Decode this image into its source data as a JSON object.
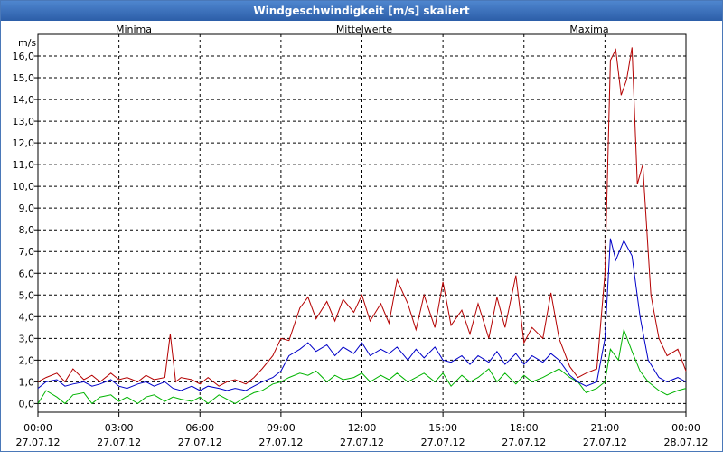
{
  "window": {
    "title": "Windgeschwindigkeit [m/s] skaliert"
  },
  "chart_data": {
    "type": "line",
    "title": "Windgeschwindigkeit [m/s] skaliert",
    "ylabel": "m/s",
    "xlabel": "",
    "ylim": [
      -0.4,
      17.0
    ],
    "xlim": [
      0,
      24
    ],
    "y_ticks": [
      0,
      1,
      2,
      3,
      4,
      5,
      6,
      7,
      8,
      9,
      10,
      11,
      12,
      13,
      14,
      15,
      16
    ],
    "y_tick_labels": [
      "0,0",
      "1,0",
      "2,0",
      "3,0",
      "4,0",
      "5,0",
      "6,0",
      "7,0",
      "8,0",
      "9,0",
      "10,0",
      "11,0",
      "12,0",
      "13,0",
      "14,0",
      "15,0",
      "16,0"
    ],
    "x_ticks": [
      {
        "time": "00:00",
        "date": "27.07.12"
      },
      {
        "time": "03:00",
        "date": "27.07.12"
      },
      {
        "time": "06:00",
        "date": "27.07.12"
      },
      {
        "time": "09:00",
        "date": "27.07.12"
      },
      {
        "time": "12:00",
        "date": "27.07.12"
      },
      {
        "time": "15:00",
        "date": "27.07.12"
      },
      {
        "time": "18:00",
        "date": "27.07.12"
      },
      {
        "time": "21:00",
        "date": "27.07.12"
      },
      {
        "time": "00:00",
        "date": "28.07.12"
      }
    ],
    "grid": true,
    "legend_position": "top",
    "series": [
      {
        "name": "Minima",
        "color": "#00b400",
        "points": [
          [
            0.0,
            0.0
          ],
          [
            0.3,
            0.6
          ],
          [
            0.7,
            0.3
          ],
          [
            1.0,
            0.0
          ],
          [
            1.3,
            0.4
          ],
          [
            1.7,
            0.5
          ],
          [
            2.0,
            0.0
          ],
          [
            2.3,
            0.3
          ],
          [
            2.7,
            0.4
          ],
          [
            3.0,
            0.1
          ],
          [
            3.3,
            0.3
          ],
          [
            3.7,
            0.0
          ],
          [
            4.0,
            0.3
          ],
          [
            4.3,
            0.4
          ],
          [
            4.7,
            0.1
          ],
          [
            5.0,
            0.3
          ],
          [
            5.3,
            0.2
          ],
          [
            5.7,
            0.1
          ],
          [
            6.0,
            0.3
          ],
          [
            6.3,
            0.0
          ],
          [
            6.7,
            0.4
          ],
          [
            7.0,
            0.2
          ],
          [
            7.3,
            0.0
          ],
          [
            7.7,
            0.3
          ],
          [
            8.0,
            0.5
          ],
          [
            8.3,
            0.6
          ],
          [
            8.7,
            0.9
          ],
          [
            9.0,
            1.0
          ],
          [
            9.3,
            1.2
          ],
          [
            9.7,
            1.4
          ],
          [
            10.0,
            1.3
          ],
          [
            10.3,
            1.5
          ],
          [
            10.7,
            1.0
          ],
          [
            11.0,
            1.3
          ],
          [
            11.3,
            1.1
          ],
          [
            11.7,
            1.2
          ],
          [
            12.0,
            1.4
          ],
          [
            12.3,
            1.0
          ],
          [
            12.7,
            1.3
          ],
          [
            13.0,
            1.1
          ],
          [
            13.3,
            1.4
          ],
          [
            13.7,
            1.0
          ],
          [
            14.0,
            1.2
          ],
          [
            14.3,
            1.4
          ],
          [
            14.7,
            1.0
          ],
          [
            15.0,
            1.4
          ],
          [
            15.3,
            0.8
          ],
          [
            15.7,
            1.3
          ],
          [
            16.0,
            1.0
          ],
          [
            16.3,
            1.2
          ],
          [
            16.7,
            1.6
          ],
          [
            17.0,
            1.0
          ],
          [
            17.3,
            1.4
          ],
          [
            17.7,
            0.9
          ],
          [
            18.0,
            1.3
          ],
          [
            18.3,
            1.0
          ],
          [
            18.7,
            1.2
          ],
          [
            19.0,
            1.4
          ],
          [
            19.3,
            1.6
          ],
          [
            19.7,
            1.2
          ],
          [
            20.0,
            1.0
          ],
          [
            20.3,
            0.5
          ],
          [
            20.7,
            0.7
          ],
          [
            21.0,
            1.0
          ],
          [
            21.2,
            2.5
          ],
          [
            21.5,
            2.0
          ],
          [
            21.7,
            3.4
          ],
          [
            22.0,
            2.4
          ],
          [
            22.3,
            1.5
          ],
          [
            22.6,
            1.0
          ],
          [
            23.0,
            0.6
          ],
          [
            23.3,
            0.4
          ],
          [
            23.7,
            0.6
          ],
          [
            24.0,
            0.7
          ]
        ]
      },
      {
        "name": "Mittelwerte",
        "color": "#0000c8",
        "points": [
          [
            0.0,
            0.7
          ],
          [
            0.3,
            1.0
          ],
          [
            0.7,
            1.1
          ],
          [
            1.0,
            0.8
          ],
          [
            1.3,
            0.9
          ],
          [
            1.7,
            1.0
          ],
          [
            2.0,
            0.8
          ],
          [
            2.3,
            0.9
          ],
          [
            2.7,
            1.1
          ],
          [
            3.0,
            0.8
          ],
          [
            3.3,
            0.7
          ],
          [
            3.7,
            0.9
          ],
          [
            4.0,
            1.0
          ],
          [
            4.3,
            0.8
          ],
          [
            4.7,
            1.0
          ],
          [
            5.0,
            0.7
          ],
          [
            5.3,
            0.6
          ],
          [
            5.7,
            0.8
          ],
          [
            6.0,
            0.6
          ],
          [
            6.3,
            0.8
          ],
          [
            6.7,
            0.7
          ],
          [
            7.0,
            0.6
          ],
          [
            7.3,
            0.7
          ],
          [
            7.7,
            0.6
          ],
          [
            8.0,
            0.8
          ],
          [
            8.3,
            1.0
          ],
          [
            8.7,
            1.2
          ],
          [
            9.0,
            1.5
          ],
          [
            9.3,
            2.2
          ],
          [
            9.7,
            2.5
          ],
          [
            10.0,
            2.8
          ],
          [
            10.3,
            2.4
          ],
          [
            10.7,
            2.7
          ],
          [
            11.0,
            2.2
          ],
          [
            11.3,
            2.6
          ],
          [
            11.7,
            2.3
          ],
          [
            12.0,
            2.8
          ],
          [
            12.3,
            2.2
          ],
          [
            12.7,
            2.5
          ],
          [
            13.0,
            2.3
          ],
          [
            13.3,
            2.6
          ],
          [
            13.7,
            2.0
          ],
          [
            14.0,
            2.5
          ],
          [
            14.3,
            2.1
          ],
          [
            14.7,
            2.6
          ],
          [
            15.0,
            2.0
          ],
          [
            15.3,
            1.9
          ],
          [
            15.7,
            2.2
          ],
          [
            16.0,
            1.8
          ],
          [
            16.3,
            2.2
          ],
          [
            16.7,
            1.9
          ],
          [
            17.0,
            2.4
          ],
          [
            17.3,
            1.8
          ],
          [
            17.7,
            2.3
          ],
          [
            18.0,
            1.8
          ],
          [
            18.3,
            2.2
          ],
          [
            18.7,
            1.9
          ],
          [
            19.0,
            2.3
          ],
          [
            19.3,
            2.0
          ],
          [
            19.7,
            1.3
          ],
          [
            20.0,
            1.0
          ],
          [
            20.3,
            0.8
          ],
          [
            20.7,
            1.0
          ],
          [
            21.0,
            3.0
          ],
          [
            21.2,
            7.6
          ],
          [
            21.4,
            6.6
          ],
          [
            21.7,
            7.5
          ],
          [
            22.0,
            6.8
          ],
          [
            22.3,
            4.0
          ],
          [
            22.6,
            2.0
          ],
          [
            23.0,
            1.2
          ],
          [
            23.3,
            1.0
          ],
          [
            23.7,
            1.2
          ],
          [
            24.0,
            1.0
          ]
        ]
      },
      {
        "name": "Maxima",
        "color": "#b40000",
        "points": [
          [
            0.0,
            1.0
          ],
          [
            0.3,
            1.2
          ],
          [
            0.7,
            1.4
          ],
          [
            1.0,
            1.0
          ],
          [
            1.3,
            1.6
          ],
          [
            1.7,
            1.1
          ],
          [
            2.0,
            1.3
          ],
          [
            2.3,
            1.0
          ],
          [
            2.7,
            1.4
          ],
          [
            3.0,
            1.1
          ],
          [
            3.3,
            1.2
          ],
          [
            3.7,
            1.0
          ],
          [
            4.0,
            1.3
          ],
          [
            4.3,
            1.1
          ],
          [
            4.7,
            1.2
          ],
          [
            4.9,
            3.2
          ],
          [
            5.1,
            1.0
          ],
          [
            5.3,
            1.2
          ],
          [
            5.7,
            1.1
          ],
          [
            6.0,
            0.9
          ],
          [
            6.3,
            1.2
          ],
          [
            6.7,
            0.8
          ],
          [
            7.0,
            1.0
          ],
          [
            7.3,
            1.1
          ],
          [
            7.7,
            0.9
          ],
          [
            8.0,
            1.2
          ],
          [
            8.3,
            1.6
          ],
          [
            8.7,
            2.2
          ],
          [
            9.0,
            3.0
          ],
          [
            9.3,
            2.9
          ],
          [
            9.7,
            4.4
          ],
          [
            10.0,
            4.9
          ],
          [
            10.3,
            3.9
          ],
          [
            10.7,
            4.7
          ],
          [
            11.0,
            3.8
          ],
          [
            11.3,
            4.8
          ],
          [
            11.7,
            4.2
          ],
          [
            12.0,
            5.0
          ],
          [
            12.3,
            3.8
          ],
          [
            12.7,
            4.6
          ],
          [
            13.0,
            3.7
          ],
          [
            13.3,
            5.7
          ],
          [
            13.7,
            4.6
          ],
          [
            14.0,
            3.4
          ],
          [
            14.3,
            5.0
          ],
          [
            14.7,
            3.5
          ],
          [
            15.0,
            5.6
          ],
          [
            15.3,
            3.6
          ],
          [
            15.7,
            4.3
          ],
          [
            16.0,
            3.2
          ],
          [
            16.3,
            4.6
          ],
          [
            16.7,
            3.0
          ],
          [
            17.0,
            4.9
          ],
          [
            17.3,
            3.5
          ],
          [
            17.7,
            5.9
          ],
          [
            18.0,
            2.8
          ],
          [
            18.3,
            3.5
          ],
          [
            18.7,
            3.0
          ],
          [
            19.0,
            5.1
          ],
          [
            19.3,
            3.0
          ],
          [
            19.7,
            1.7
          ],
          [
            20.0,
            1.2
          ],
          [
            20.3,
            1.4
          ],
          [
            20.7,
            1.6
          ],
          [
            21.0,
            6.0
          ],
          [
            21.2,
            15.8
          ],
          [
            21.4,
            16.3
          ],
          [
            21.6,
            14.2
          ],
          [
            21.8,
            14.9
          ],
          [
            22.0,
            16.4
          ],
          [
            22.2,
            10.1
          ],
          [
            22.4,
            11.0
          ],
          [
            22.7,
            5.0
          ],
          [
            23.0,
            3.0
          ],
          [
            23.3,
            2.2
          ],
          [
            23.7,
            2.5
          ],
          [
            24.0,
            1.5
          ]
        ]
      }
    ]
  }
}
